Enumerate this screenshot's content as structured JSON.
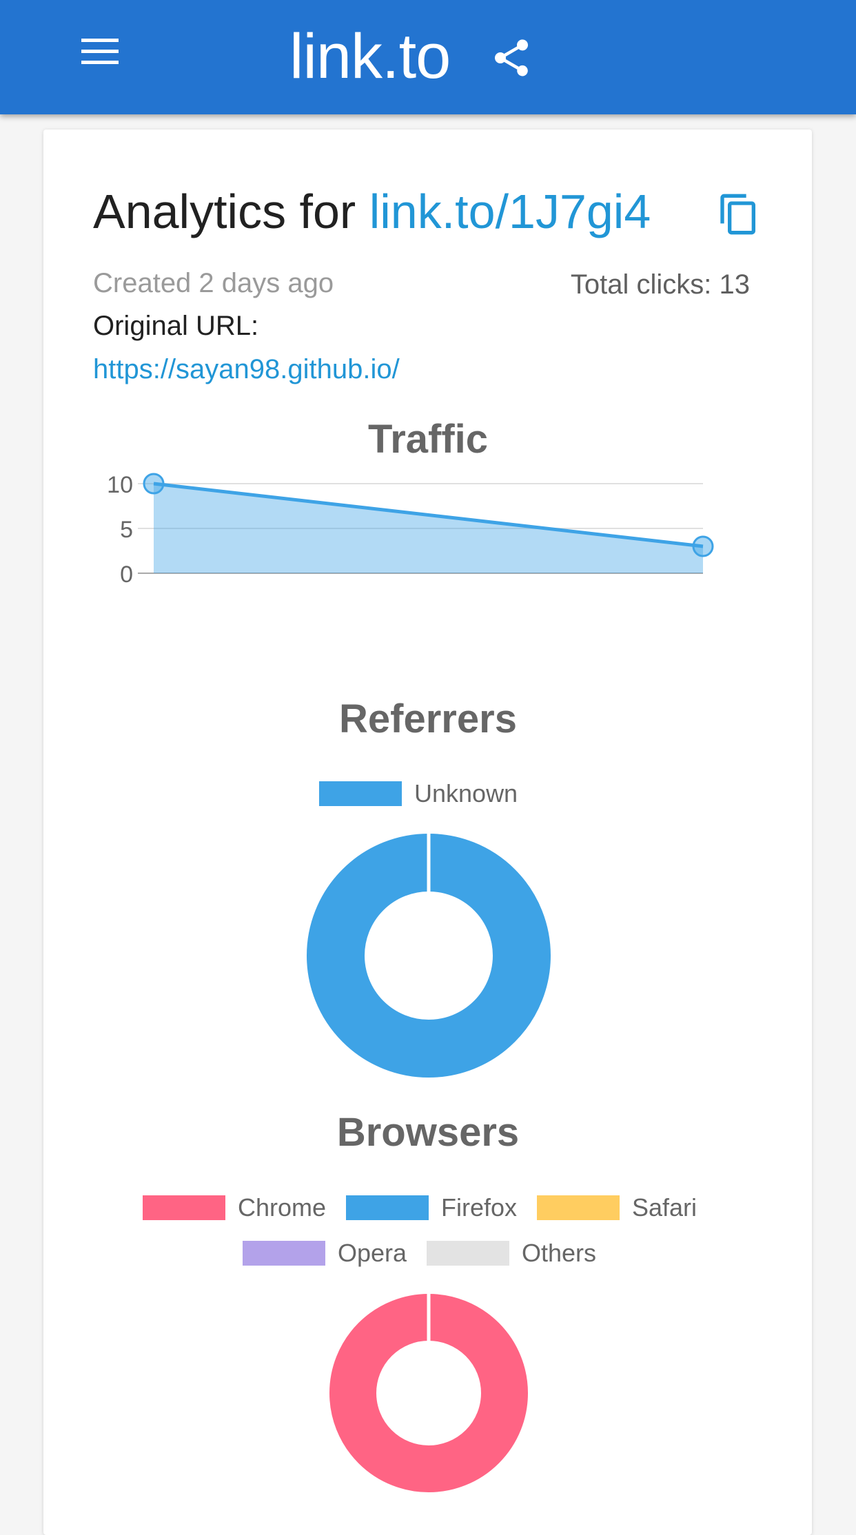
{
  "app": {
    "brand": "link.to",
    "icons": {
      "menu": "menu-icon",
      "share": "share-icon",
      "copy": "copy-icon"
    }
  },
  "analytics": {
    "heading_prefix": "Analytics for",
    "short_link": "link.to/1J7gi4",
    "created": "Created 2 days ago",
    "total_clicks": "Total clicks: 13",
    "original_url_label": "Original URL:",
    "original_url": "https://sayan98.github.io/"
  },
  "colors": {
    "appbar": "#2374d0",
    "link": "#2196d6",
    "chart_blue": "#3ea3e6",
    "chart_red": "#ff6484",
    "chart_yellow": "#ffcd60",
    "chart_purple": "#b3a2ea",
    "chart_grey": "#e3e3e3"
  },
  "chart_data": [
    {
      "type": "area",
      "title": "Traffic",
      "xlabel": "",
      "ylabel": "",
      "x": [
        "",
        ""
      ],
      "y_ticks": [
        "0",
        "5",
        "10"
      ],
      "ylim": [
        0,
        10
      ],
      "grid": true,
      "series": [
        {
          "values": [
            10,
            3
          ]
        }
      ]
    },
    {
      "type": "pie",
      "title": "Referrers",
      "legend": "top",
      "labels": [
        "Unknown"
      ],
      "values": [
        13
      ]
    },
    {
      "type": "pie",
      "title": "Browsers",
      "legend": "top",
      "labels": [
        "Chrome",
        "Firefox",
        "Safari",
        "Opera",
        "Others"
      ],
      "values": [
        13,
        0,
        0,
        0,
        0
      ]
    }
  ]
}
